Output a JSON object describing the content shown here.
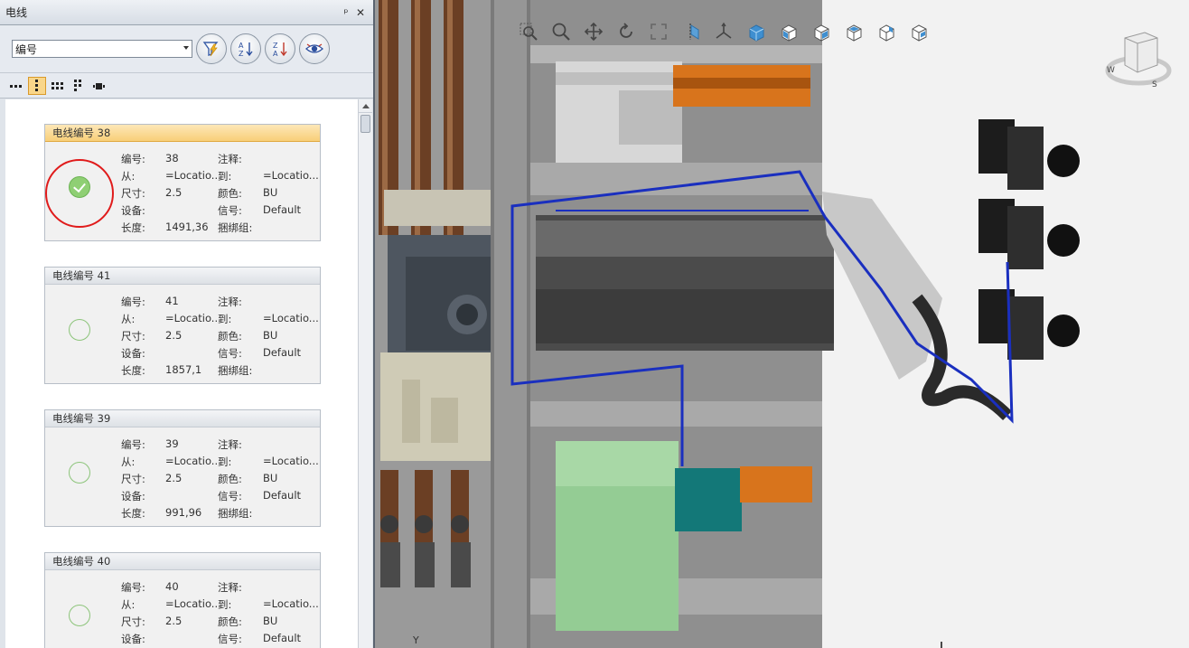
{
  "panel": {
    "title": "电线",
    "pin": "ᵖ",
    "close": "✕",
    "sort_combo": {
      "value": "编号"
    }
  },
  "labels": {
    "id": "编号:",
    "from": "从:",
    "size": "尺寸:",
    "device": "设备:",
    "length": "长度:",
    "note": "注释:",
    "to": "到:",
    "color": "颜色:",
    "signal": "信号:",
    "bundle": "捆绑组:"
  },
  "wires": [
    {
      "header": "电线编号 38",
      "id": "38",
      "from": "=Locatio...",
      "size": "2.5",
      "device": "",
      "length": "1491,36",
      "note": "",
      "to": "=Locatio...",
      "color": "BU",
      "signal": "Default",
      "bundle": "",
      "state": "done",
      "selected": true
    },
    {
      "header": "电线编号 41",
      "id": "41",
      "from": "=Locatio...",
      "size": "2.5",
      "device": "",
      "length": "1857,1",
      "note": "",
      "to": "=Locatio...",
      "color": "BU",
      "signal": "Default",
      "bundle": "",
      "state": "open",
      "selected": false
    },
    {
      "header": "电线编号 39",
      "id": "39",
      "from": "=Locatio...",
      "size": "2.5",
      "device": "",
      "length": "991,96",
      "note": "",
      "to": "=Locatio...",
      "color": "BU",
      "signal": "Default",
      "bundle": "",
      "state": "open",
      "selected": false
    },
    {
      "header": "电线编号 40",
      "id": "40",
      "from": "=Locatio...",
      "size": "2.5",
      "device": "",
      "length": "",
      "note": "",
      "to": "=Locatio...",
      "color": "BU",
      "signal": "Default",
      "bundle": "",
      "state": "open",
      "selected": false
    }
  ],
  "viewport": {
    "axis_label": "Y",
    "compass": {
      "w": "W",
      "s": "S"
    },
    "wire_color": "#1a2fbf"
  },
  "colors": {
    "selection_header": "#f8cf78",
    "done_status": "#8fcf74",
    "highlight_ring": "#e01b1b"
  }
}
